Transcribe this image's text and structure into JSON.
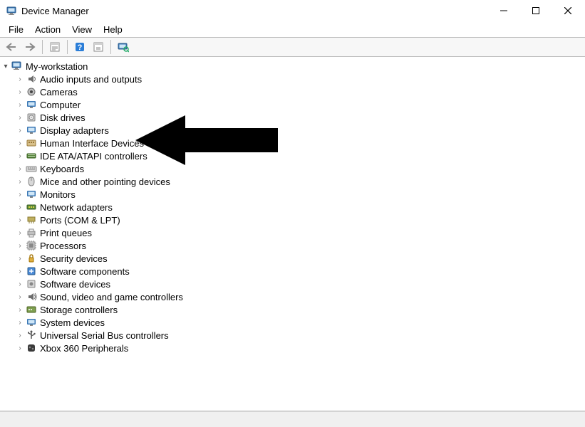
{
  "window": {
    "title": "Device Manager"
  },
  "menu": {
    "items": [
      "File",
      "Action",
      "View",
      "Help"
    ]
  },
  "tree": {
    "root": "My-workstation",
    "categories": [
      {
        "name": "audio",
        "label": "Audio inputs and outputs"
      },
      {
        "name": "cameras",
        "label": "Cameras"
      },
      {
        "name": "computer",
        "label": "Computer"
      },
      {
        "name": "disk",
        "label": "Disk drives"
      },
      {
        "name": "display",
        "label": "Display adapters"
      },
      {
        "name": "hid",
        "label": "Human Interface Devices"
      },
      {
        "name": "ide",
        "label": "IDE ATA/ATAPI controllers"
      },
      {
        "name": "keyboards",
        "label": "Keyboards"
      },
      {
        "name": "mice",
        "label": "Mice and other pointing devices"
      },
      {
        "name": "monitors",
        "label": "Monitors"
      },
      {
        "name": "network",
        "label": "Network adapters"
      },
      {
        "name": "ports",
        "label": "Ports (COM & LPT)"
      },
      {
        "name": "print",
        "label": "Print queues"
      },
      {
        "name": "processors",
        "label": "Processors"
      },
      {
        "name": "security",
        "label": "Security devices"
      },
      {
        "name": "swcomp",
        "label": "Software components"
      },
      {
        "name": "swdev",
        "label": "Software devices"
      },
      {
        "name": "sound",
        "label": "Sound, video and game controllers"
      },
      {
        "name": "storage",
        "label": "Storage controllers"
      },
      {
        "name": "system",
        "label": "System devices"
      },
      {
        "name": "usb",
        "label": "Universal Serial Bus controllers"
      },
      {
        "name": "xbox",
        "label": "Xbox 360 Peripherals"
      }
    ]
  },
  "annotation": {
    "arrow_points_to": "display"
  }
}
